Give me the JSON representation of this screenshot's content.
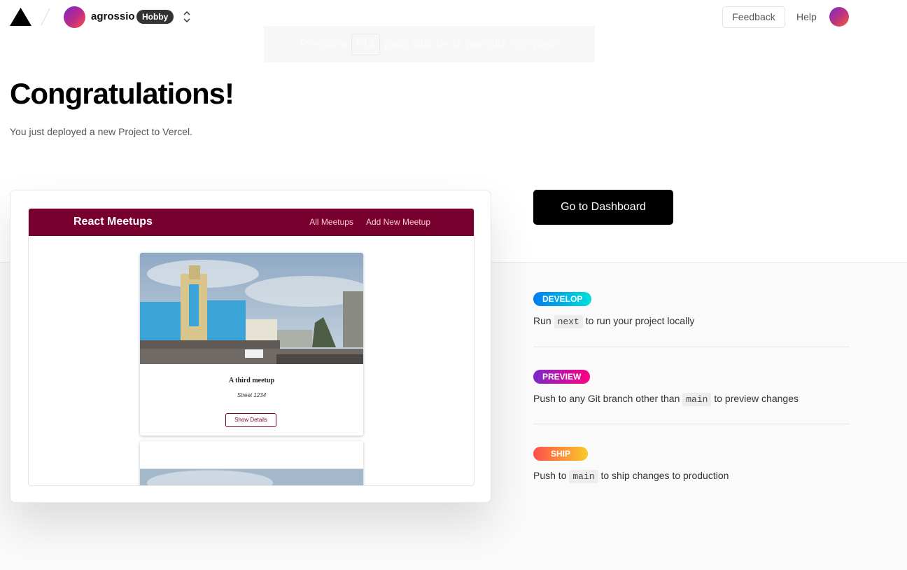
{
  "header": {
    "team_name": "agrossio",
    "plan_badge": "Hobby",
    "feedback_label": "Feedback",
    "help_label": "Help"
  },
  "fullscreen_notice": {
    "before": "Presiona",
    "key": "F11",
    "after": "para salir de la pantalla completa"
  },
  "hero": {
    "title": "Congratulations!",
    "subtitle": "You just deployed a new Project to Vercel."
  },
  "preview": {
    "app_title": "React Meetups",
    "nav": [
      "All Meetups",
      "Add New Meetup"
    ],
    "meetups": [
      {
        "title": "A third meetup",
        "address": "Street 1234",
        "button": "Show Details"
      }
    ]
  },
  "actions": {
    "dashboard_label": "Go to Dashboard"
  },
  "steps": [
    {
      "badge": "DEVELOP",
      "text_before": "Run",
      "code": "next",
      "text_after": "to run your project locally"
    },
    {
      "badge": "PREVIEW",
      "text_before": "Push to any Git branch other than",
      "code": "main",
      "text_after": "to preview changes"
    },
    {
      "badge": "SHIP",
      "text_before": "Push to",
      "code": "main",
      "text_after": "to ship changes to production"
    }
  ],
  "colors": {
    "app_brand": "#77002e",
    "develop_gradient": [
      "#007cf0",
      "#00dfd8"
    ],
    "preview_gradient": [
      "#7928ca",
      "#ff0080"
    ],
    "ship_gradient": [
      "#ff4d4d",
      "#f9cb28"
    ]
  },
  "icons": [
    "vercel-logo-icon",
    "slash-separator-icon",
    "team-avatar",
    "chevron-up-down-icon",
    "user-avatar"
  ]
}
